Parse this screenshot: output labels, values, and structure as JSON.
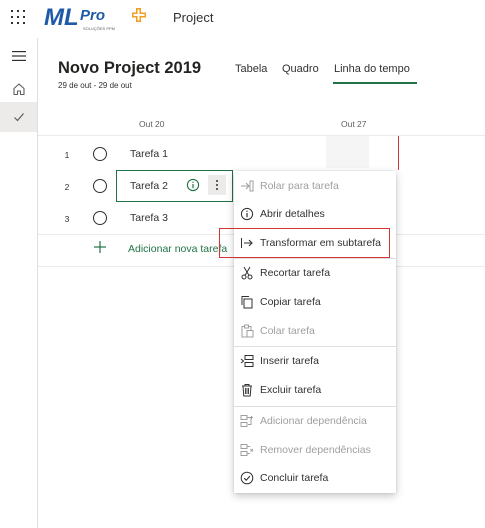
{
  "header": {
    "app_name": "Project",
    "logo": {
      "brand": "MLPro",
      "ml": "ML",
      "pro": "Pro",
      "tagline": "SOLUÇÕES PPM"
    }
  },
  "project": {
    "title": "Novo Project 2019",
    "date_range": "29 de out - 29 de out"
  },
  "view_tabs": [
    {
      "label": "Tabela",
      "active": false
    },
    {
      "label": "Quadro",
      "active": false
    },
    {
      "label": "Linha do tempo",
      "active": true
    }
  ],
  "timeline": {
    "dates": [
      "Out 20",
      "Out 27"
    ]
  },
  "tasks": [
    {
      "num": "1",
      "name": "Tarefa 1"
    },
    {
      "num": "2",
      "name": "Tarefa 2"
    },
    {
      "num": "3",
      "name": "Tarefa 3"
    }
  ],
  "add_task_label": "Adicionar nova tarefa",
  "context_menu": {
    "items": [
      {
        "label": "Rolar para tarefa",
        "icon": "scroll-to-task-icon",
        "enabled": false
      },
      {
        "label": "Abrir detalhes",
        "icon": "info-icon",
        "enabled": true
      },
      {
        "label": "Transformar em subtarefa",
        "icon": "indent-icon",
        "enabled": true,
        "highlighted": true
      },
      {
        "label": "Recortar tarefa",
        "icon": "scissors-icon",
        "enabled": true
      },
      {
        "label": "Copiar tarefa",
        "icon": "copy-icon",
        "enabled": true
      },
      {
        "label": "Colar tarefa",
        "icon": "paste-icon",
        "enabled": false
      },
      {
        "label": "Inserir tarefa",
        "icon": "insert-icon",
        "enabled": true
      },
      {
        "label": "Excluir tarefa",
        "icon": "trash-icon",
        "enabled": true
      },
      {
        "label": "Adicionar dependência",
        "icon": "add-dependency-icon",
        "enabled": false
      },
      {
        "label": "Remover dependências",
        "icon": "remove-dependency-icon",
        "enabled": false
      },
      {
        "label": "Concluir tarefa",
        "icon": "check-circle-icon",
        "enabled": true
      }
    ]
  },
  "colors": {
    "accent_green": "#217346",
    "highlight_red": "#d13438",
    "logo_blue": "#1e5aa8",
    "logo_orange": "#f39c1f"
  }
}
